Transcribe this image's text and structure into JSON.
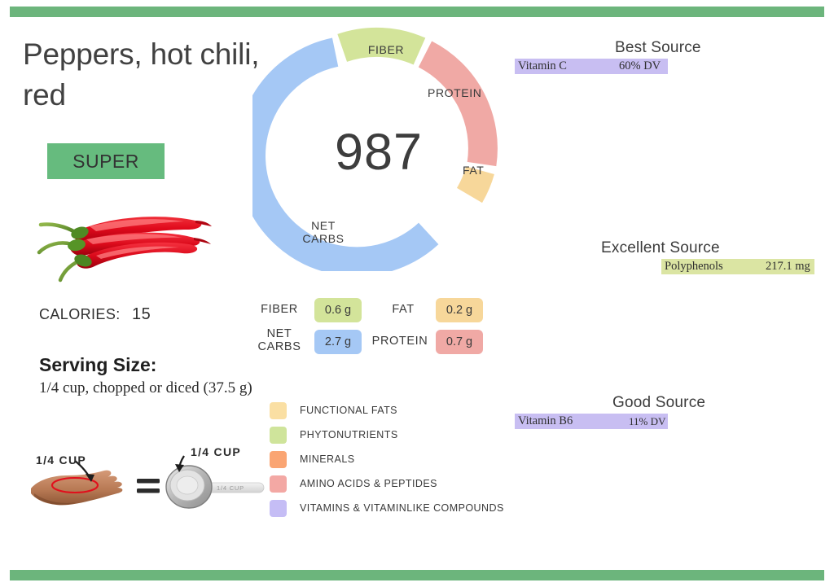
{
  "page": {
    "title": "Peppers, hot chili, red",
    "badge": "SUPER",
    "accent_green": "#6cb57c",
    "badge_green": "#66bb7e"
  },
  "calories": {
    "label": "CALORIES:",
    "value": "15"
  },
  "serving": {
    "heading": "Serving Size:",
    "text": "1/4 cup, chopped or diced (37.5 g)",
    "hand_label": "1/4 CUP",
    "spoon_label": "1/4 CUP",
    "spoon_imprint": "1/4  CUP",
    "equals": "="
  },
  "chart_data": {
    "type": "pie",
    "title": "987",
    "center_value": "987",
    "categories": [
      "NET CARBS",
      "FIBER",
      "PROTEIN",
      "FAT"
    ],
    "values": [
      2.7,
      0.6,
      0.7,
      0.2
    ],
    "units": "g",
    "colors": [
      "#a5c8f5",
      "#d3e49a",
      "#f0a9a5",
      "#f7d79a"
    ],
    "labels": [
      "NET CARBS",
      "FIBER",
      "PROTEIN",
      "FAT"
    ],
    "legend": "inside-slices",
    "donut": true
  },
  "macros": {
    "items": [
      {
        "name": "FIBER",
        "value": "0.6 g",
        "color": "#d3e49a"
      },
      {
        "name": "FAT",
        "value": "0.2 g",
        "color": "#f7d79a"
      },
      {
        "name": "NET CARBS",
        "value": "2.7 g",
        "color": "#a5c8f5"
      },
      {
        "name": "PROTEIN",
        "value": "0.7 g",
        "color": "#f0a9a5"
      }
    ]
  },
  "legend": {
    "items": [
      {
        "label": "FUNCTIONAL  FATS",
        "color": "#fadfa3"
      },
      {
        "label": "PHYTONUTRIENTS",
        "color": "#cfe49b"
      },
      {
        "label": "MINERALS",
        "color": "#faa573"
      },
      {
        "label": "AMINO ACIDS & PEPTIDES",
        "color": "#f3a8a4"
      },
      {
        "label": "VITAMINS & VITAMINLIKE COMPOUNDS",
        "color": "#c5bdf5"
      }
    ]
  },
  "sources": [
    {
      "heading": "Best Source",
      "nutrient": "Vitamin C",
      "amount": "60% DV",
      "color": "#c8bef2"
    },
    {
      "heading": "Excellent Source",
      "nutrient": "Polyphenols",
      "amount": "217.1 mg",
      "color": "#dbe5a3"
    },
    {
      "heading": "Good Source",
      "nutrient": "Vitamin B6",
      "amount": "11% DV",
      "color": "#c8bef2"
    }
  ]
}
